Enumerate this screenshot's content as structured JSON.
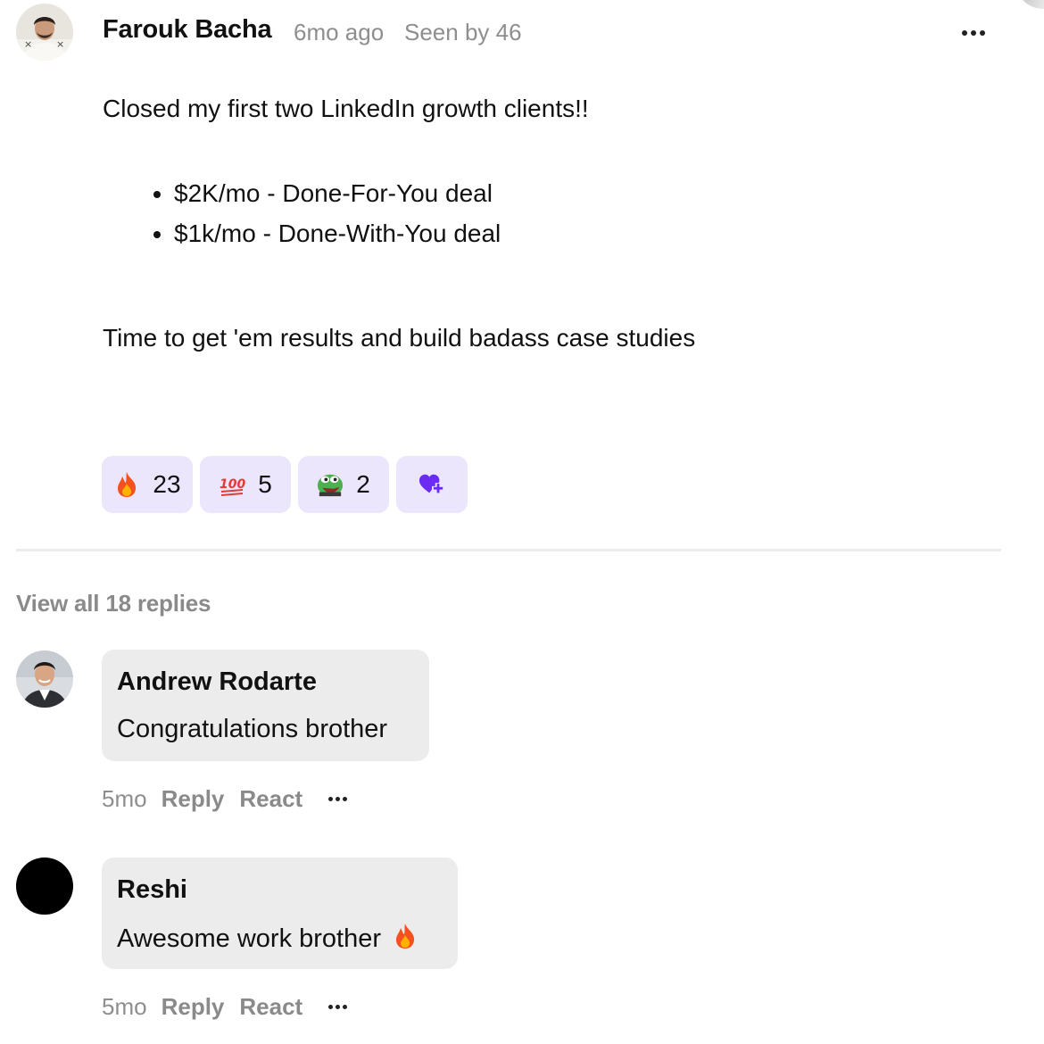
{
  "post": {
    "author": "Farouk Bacha",
    "time": "6mo ago",
    "seen": "Seen by 46",
    "intro": "Closed my first two LinkedIn growth clients!!",
    "deals": [
      "$2K/mo - Done-For-You deal",
      "$1k/mo - Done-With-You deal"
    ],
    "closing": "Time to get 'em results and build badass case studies",
    "more_icon": "ellipsis-icon"
  },
  "reactions": [
    {
      "icon": "fire-emoji",
      "count": "23"
    },
    {
      "icon": "hundred-points-emoji",
      "count": "5"
    },
    {
      "icon": "pepe-frog-emoji",
      "count": "2"
    },
    {
      "icon": "add-reaction-heart-plus-icon"
    }
  ],
  "replies": {
    "view_all": "View all 18 replies"
  },
  "comments": [
    {
      "author": "Andrew Rodarte",
      "text": "Congratulations brother",
      "time": "5mo",
      "reply_label": "Reply",
      "react_label": "React"
    },
    {
      "author": "Reshi",
      "text": "Awesome work brother",
      "text_emoji": "fire-emoji",
      "time": "5mo",
      "reply_label": "Reply",
      "react_label": "React"
    }
  ],
  "colors": {
    "reaction_bg": "#ece6fd",
    "accent_purple": "#6b2bf2",
    "bubble_bg": "#ececec",
    "muted_text": "#8e8e8e"
  }
}
